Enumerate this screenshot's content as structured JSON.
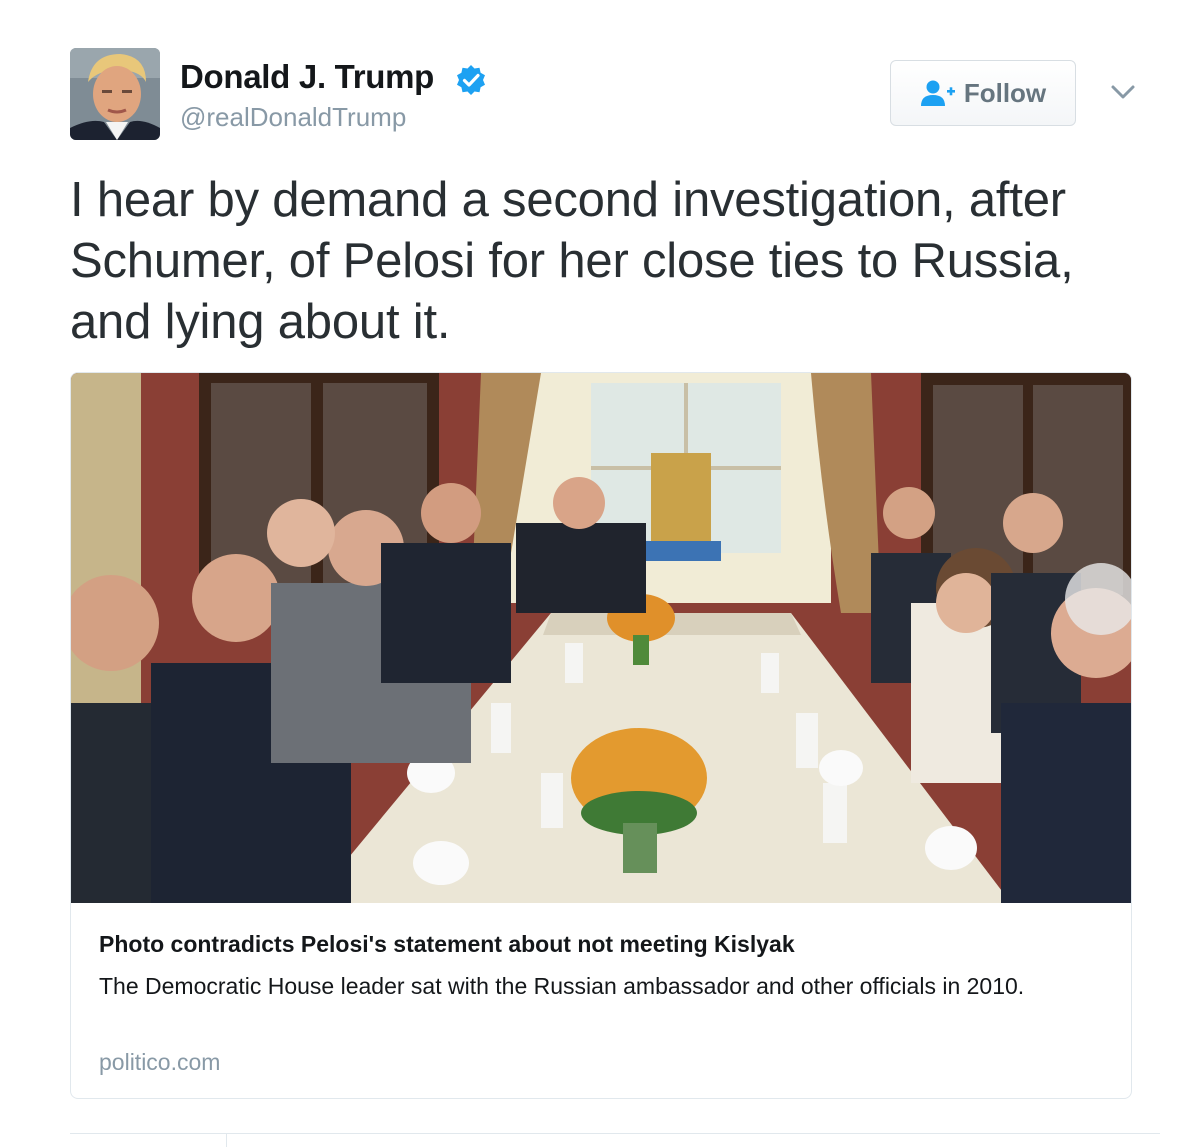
{
  "tweet": {
    "author": {
      "name": "Donald J. Trump",
      "handle": "@realDonaldTrump",
      "avatar_icon": "profile-photo",
      "verified": true,
      "verified_color": "#1da1f2"
    },
    "follow_label": "Follow",
    "follow_icon": "follow-person-icon",
    "menu_icon": "chevron-down-icon",
    "text": "I hear by demand a second investigation, after Schumer, of Pelosi for her close ties to Russia, and lying about it."
  },
  "card": {
    "image_icon": "meeting-photo",
    "title": "Photo contradicts Pelosi's statement about not meeting Kislyak",
    "description": "The Democratic House leader sat with the Russian ambassador and other officials in 2010.",
    "domain": "politico.com"
  },
  "colors": {
    "text": "#292f33",
    "muted": "#8899a6",
    "border": "#e1e8ed",
    "verified": "#1da1f2"
  }
}
